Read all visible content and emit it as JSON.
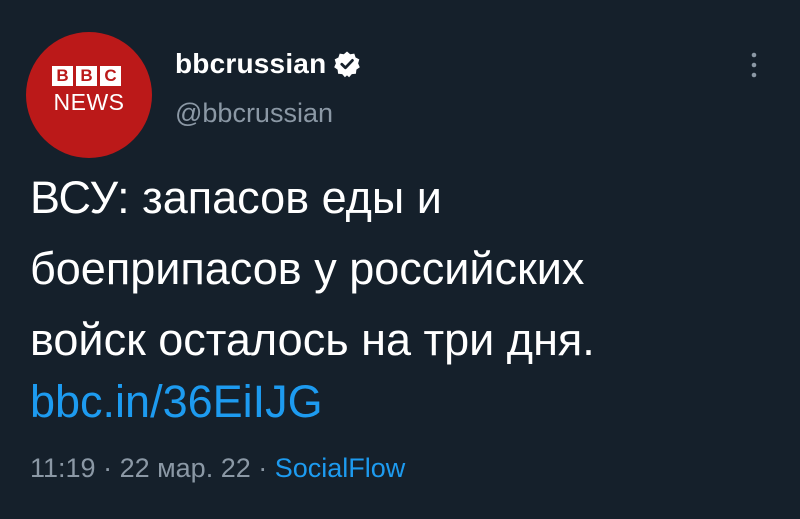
{
  "colors": {
    "background": "#15202b",
    "text": "#ffffff",
    "muted": "#8b98a5",
    "link": "#1d9bf0",
    "avatar_brand": "#bb1919"
  },
  "author": {
    "avatar": {
      "logo_letters": [
        "B",
        "B",
        "C"
      ],
      "logo_subtext": "NEWS"
    },
    "display_name": "bbcrussian",
    "verified_icon": "verified-badge-icon",
    "handle": "@bbcrussian"
  },
  "menu": {
    "icon": "more-vertical-icon"
  },
  "tweet": {
    "text": "ВСУ: запасов еды и\nбоеприпасов у российских\nвойск осталось на три дня.",
    "link": "bbc.in/36EiIJG"
  },
  "meta": {
    "time": "11:19",
    "separator_1": " · ",
    "date": "22 мар. 22",
    "separator_2": " · ",
    "source": "SocialFlow"
  }
}
